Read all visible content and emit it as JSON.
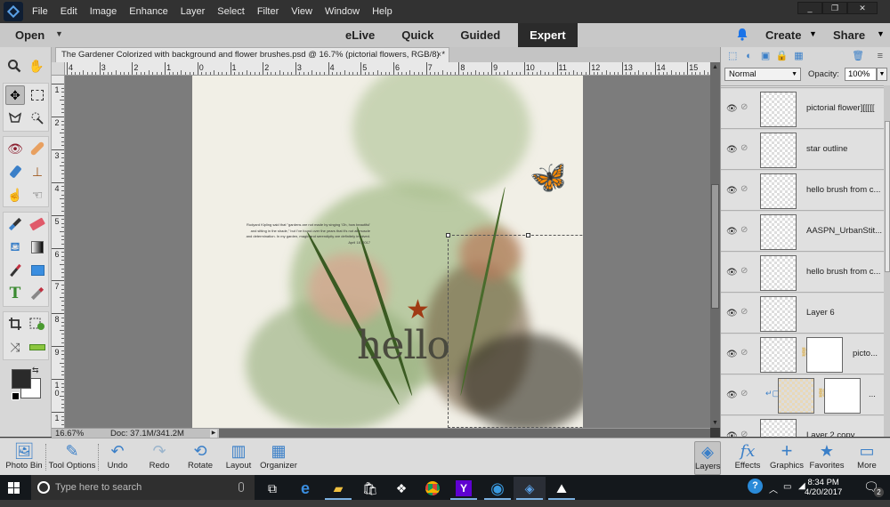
{
  "menubar": {
    "items": [
      "File",
      "Edit",
      "Image",
      "Enhance",
      "Layer",
      "Select",
      "Filter",
      "View",
      "Window",
      "Help"
    ],
    "window_controls": {
      "minimize": "_",
      "restore": "❐",
      "close": "✕"
    }
  },
  "modebar": {
    "open_label": "Open",
    "modes": [
      {
        "label": "eLive",
        "active": false
      },
      {
        "label": "Quick",
        "active": false
      },
      {
        "label": "Guided",
        "active": false
      },
      {
        "label": "Expert",
        "active": true
      }
    ],
    "create_label": "Create",
    "share_label": "Share",
    "accent_color": "#1a73e8"
  },
  "document": {
    "tab_title": "The Gardener Colorized with background and flower brushes.psd @ 16.7% (pictorial flowers, RGB/8) *",
    "close_glyph": "×",
    "ruler_h_labels": [
      "4",
      "3",
      "2",
      "1",
      "0",
      "1",
      "2",
      "3",
      "4",
      "5",
      "6",
      "7",
      "8",
      "9",
      "10",
      "11",
      "12",
      "13",
      "14",
      "15"
    ],
    "ruler_v_labels": [
      "1",
      "2",
      "3",
      "4",
      "5",
      "6",
      "7",
      "8",
      "9",
      "10",
      "1"
    ],
    "canvas_text": {
      "hello": "hello",
      "quote": "Rudyard Kipling said that \"gardens are not made by singing 'Oh, how beautiful' and sitting in the shade,\" but I've found over the years that it's not all muscle and determination. In my garden, magic and serendipity are definitely involved.",
      "quote_date": "April 18, 2017"
    }
  },
  "status": {
    "zoom": "16.67%",
    "doc_size": "Doc: 37.1M/341.2M"
  },
  "toolbox": {
    "tools": [
      "zoom",
      "hand",
      "move",
      "rectangular-marquee",
      "lasso",
      "quick-selection",
      "red-eye",
      "spot-healing",
      "smart-brush",
      "clone-stamp",
      "blur",
      "smudge",
      "brush",
      "eraser",
      "paint-bucket",
      "gradient",
      "eyedropper",
      "custom-shape",
      "type",
      "pencil",
      "crop",
      "recompose",
      "content-aware-move",
      "straighten"
    ],
    "selected_tool": "move",
    "foreground_color": "#2a2a2a",
    "background_color": "#ffffff"
  },
  "layers_panel": {
    "blend_mode": "Normal",
    "opacity_label": "Opacity:",
    "opacity_value": "100%",
    "layers": [
      {
        "name": "pictorial flower][[[[[",
        "visible": true,
        "has_mask": false
      },
      {
        "name": "star outline",
        "visible": true,
        "has_mask": false
      },
      {
        "name": "hello brush from c...",
        "visible": true,
        "has_mask": false
      },
      {
        "name": "AASPN_UrbanStit...",
        "visible": true,
        "has_mask": false
      },
      {
        "name": "hello brush from c...",
        "visible": true,
        "has_mask": false
      },
      {
        "name": "Layer 6",
        "visible": true,
        "has_mask": false
      },
      {
        "name": "picto...",
        "visible": true,
        "has_mask": true
      },
      {
        "name": "...",
        "visible": true,
        "has_mask": true,
        "clipped": true
      },
      {
        "name": "Layer 2 copy",
        "visible": true,
        "has_mask": false
      }
    ]
  },
  "taskpane": {
    "left": [
      {
        "label": "Photo Bin",
        "icon": "photo-bin-icon"
      },
      {
        "label": "Tool Options",
        "icon": "tool-options-icon"
      },
      {
        "label": "Undo",
        "icon": "undo-icon"
      },
      {
        "label": "Redo",
        "icon": "redo-icon"
      },
      {
        "label": "Rotate",
        "icon": "rotate-icon"
      },
      {
        "label": "Layout",
        "icon": "layout-icon"
      },
      {
        "label": "Organizer",
        "icon": "organizer-icon"
      }
    ],
    "right": [
      {
        "label": "Layers",
        "icon": "layers-icon",
        "active": true
      },
      {
        "label": "Effects",
        "icon": "effects-icon"
      },
      {
        "label": "Graphics",
        "icon": "graphics-icon"
      },
      {
        "label": "Favorites",
        "icon": "favorites-icon"
      },
      {
        "label": "More",
        "icon": "more-icon"
      }
    ]
  },
  "win_taskbar": {
    "search_placeholder": "Type here to search",
    "apps": [
      "task-view",
      "edge",
      "file-explorer",
      "store",
      "dropbox",
      "chrome",
      "yahoo",
      "thunderbird",
      "photoshop-elements",
      "photos"
    ],
    "time": "8:34 PM",
    "date": "4/20/2017",
    "notification_count": "2"
  }
}
